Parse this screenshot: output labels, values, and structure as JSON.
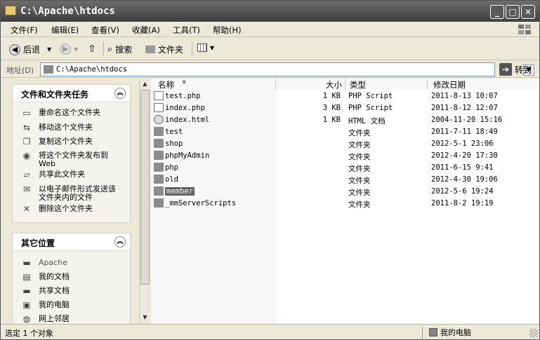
{
  "window": {
    "title": "C:\\Apache\\htdocs",
    "minimize": "_",
    "maximize": "□",
    "close": "✕"
  },
  "menu": [
    "文件(F)",
    "编辑(E)",
    "查看(V)",
    "收藏(A)",
    "工具(T)",
    "帮助(H)"
  ],
  "toolbar": {
    "back": "后退",
    "search": "搜索",
    "folders": "文件夹"
  },
  "address": {
    "label": "地址(D)",
    "value": "C:\\Apache\\htdocs",
    "go": "转到"
  },
  "tasks_panel": {
    "title": "文件和文件夹任务",
    "items": [
      {
        "label": "重命名这个文件夹",
        "icon": "rename-icon"
      },
      {
        "label": "移动这个文件夹",
        "icon": "move-icon"
      },
      {
        "label": "复制这个文件夹",
        "icon": "copy-icon"
      },
      {
        "label": "将这个文件夹发布到 Web",
        "icon": "publish-web-icon"
      },
      {
        "label": "共享此文件夹",
        "icon": "share-icon"
      },
      {
        "label": "以电子邮件形式发送该文件夹内的文件",
        "icon": "email-icon"
      },
      {
        "label": "删除这个文件夹",
        "icon": "delete-icon"
      }
    ]
  },
  "places_panel": {
    "title": "其它位置",
    "items": [
      {
        "label": "Apache",
        "icon": "folder-icon"
      },
      {
        "label": "我的文档",
        "icon": "my-documents-icon"
      },
      {
        "label": "共享文档",
        "icon": "shared-documents-icon"
      },
      {
        "label": "我的电脑",
        "icon": "my-computer-icon"
      },
      {
        "label": "网上邻居",
        "icon": "network-icon"
      }
    ]
  },
  "columns": {
    "name": "名称",
    "size": "大小",
    "type": "类型",
    "modified": "修改日期"
  },
  "files": [
    {
      "name": "test.php",
      "size": "1 KB",
      "type": "PHP Script",
      "modified": "2011-8-13 10:07",
      "kind": "doc"
    },
    {
      "name": "index.php",
      "size": "3 KB",
      "type": "PHP Script",
      "modified": "2011-8-12 12:07",
      "kind": "doc"
    },
    {
      "name": "index.html",
      "size": "1 KB",
      "type": "HTML 文档",
      "modified": "2004-11-20 15:16",
      "kind": "html"
    },
    {
      "name": "test",
      "size": "",
      "type": "文件夹",
      "modified": "2011-7-11 18:49",
      "kind": "folder"
    },
    {
      "name": "shop",
      "size": "",
      "type": "文件夹",
      "modified": "2012-5-1 23:06",
      "kind": "folder"
    },
    {
      "name": "phpMyAdmin",
      "size": "",
      "type": "文件夹",
      "modified": "2012-4-20 17:30",
      "kind": "folder"
    },
    {
      "name": "php",
      "size": "",
      "type": "文件夹",
      "modified": "2011-6-15 9:41",
      "kind": "folder"
    },
    {
      "name": "old",
      "size": "",
      "type": "文件夹",
      "modified": "2012-4-30 19:06",
      "kind": "folder"
    },
    {
      "name": "member",
      "size": "",
      "type": "文件夹",
      "modified": "2012-5-6 19:24",
      "kind": "folder",
      "selected": true
    },
    {
      "name": "_mmServerScripts",
      "size": "",
      "type": "文件夹",
      "modified": "2011-8-2 19:19",
      "kind": "folder"
    }
  ],
  "status": {
    "left": "选定 1 个对象",
    "right": "我的电脑"
  }
}
